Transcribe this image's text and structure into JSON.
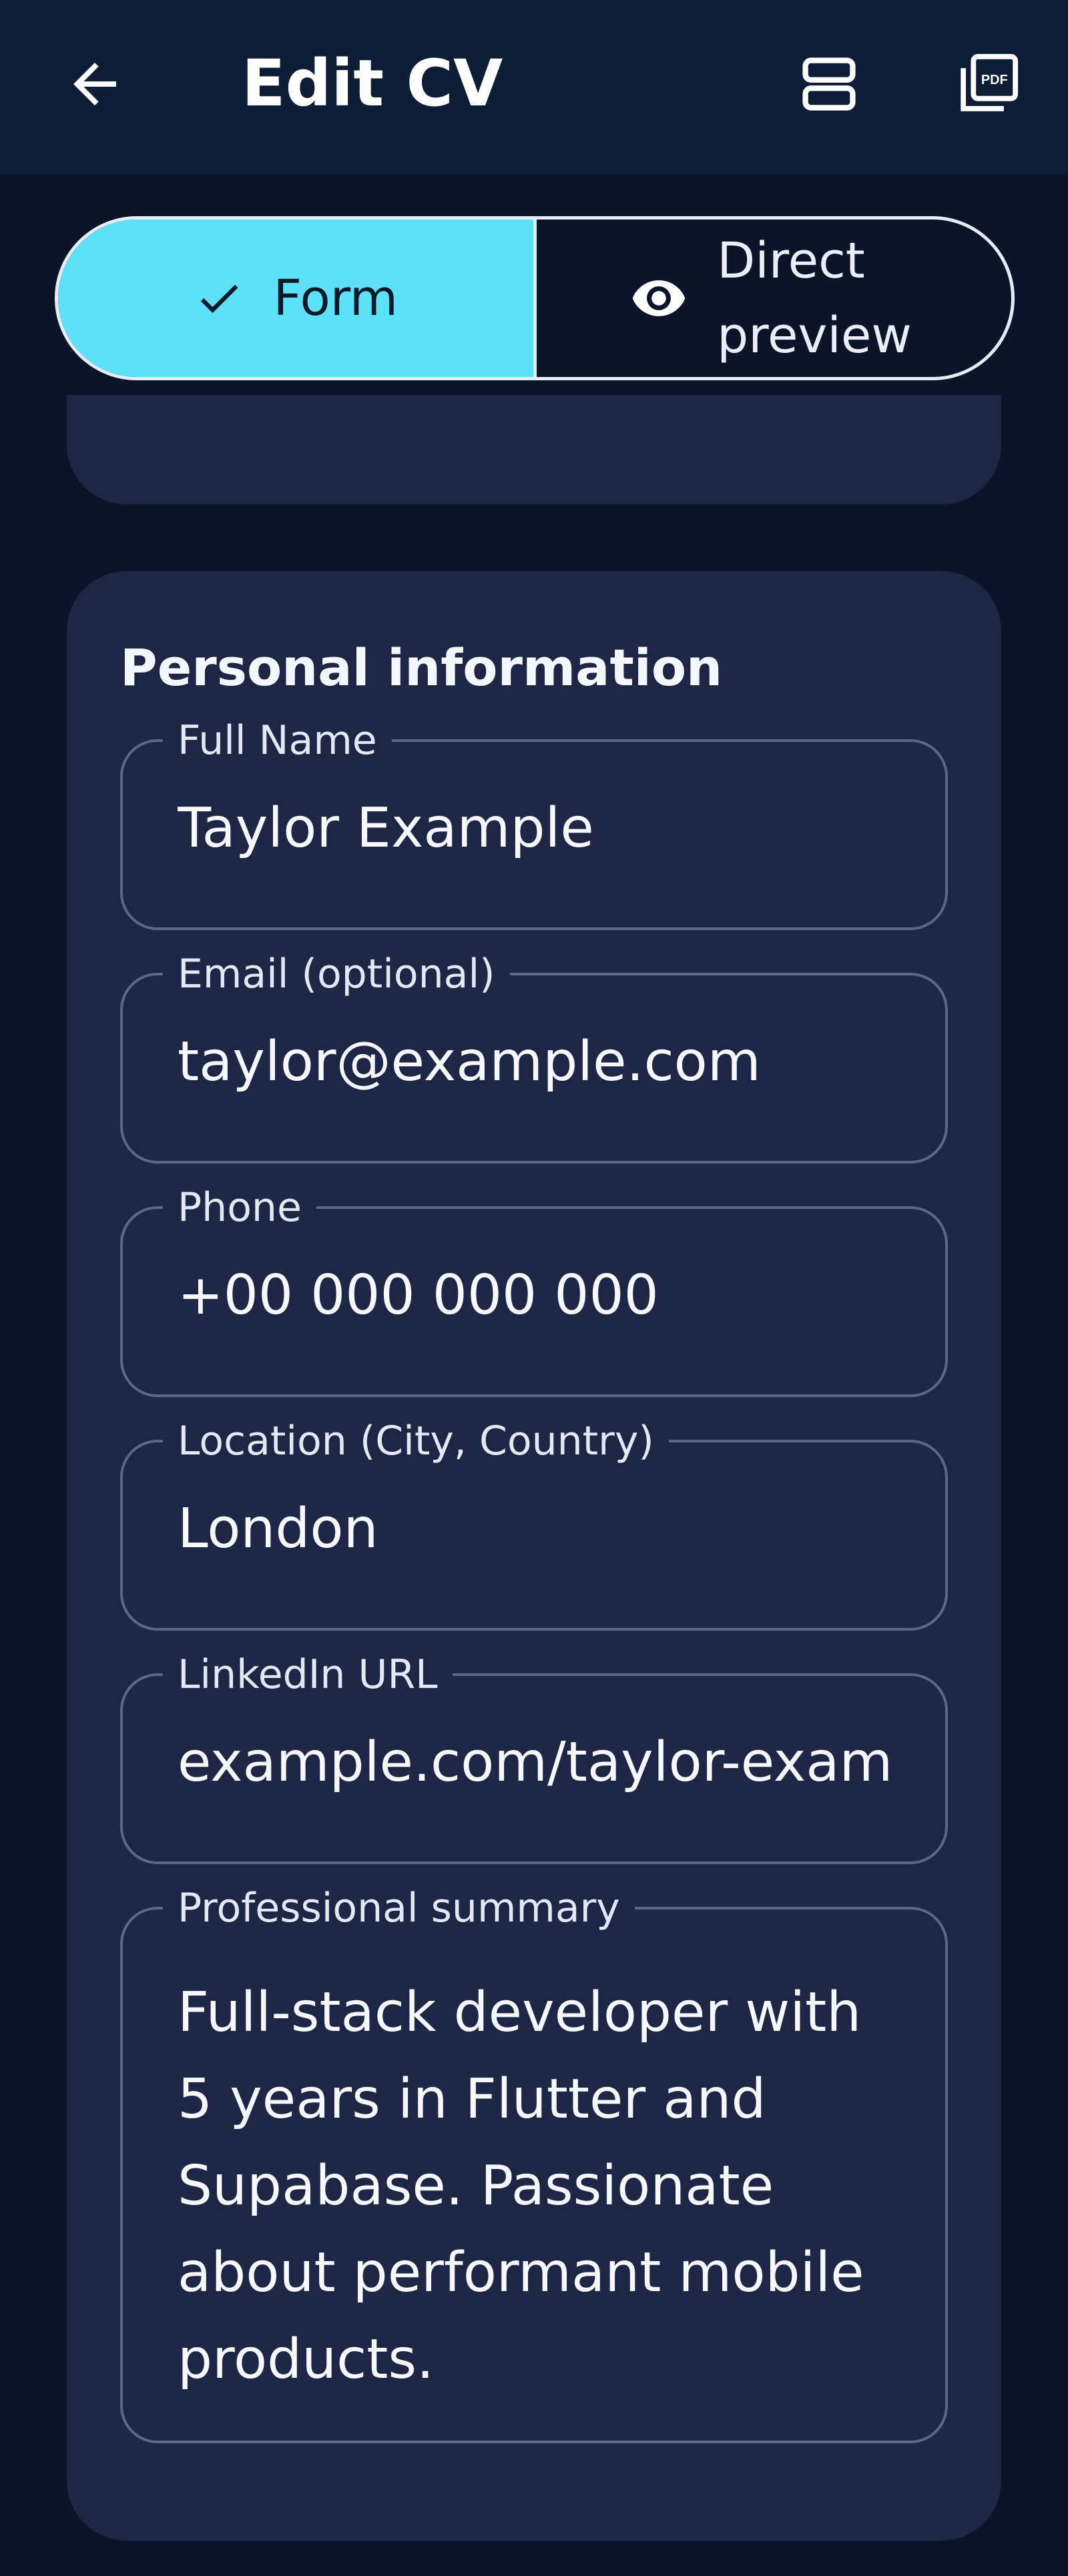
{
  "appbar": {
    "title": "Edit CV",
    "back_icon": "arrow-left-icon",
    "layout_icon": "view-agenda-icon",
    "pdf_icon": "picture-as-pdf-icon"
  },
  "toggle": {
    "form_label": "Form",
    "preview_label": "Direct preview",
    "selected": "Form"
  },
  "card": {
    "title": "Personal information",
    "fields": [
      {
        "label": "Full Name",
        "value": "Taylor Example"
      },
      {
        "label": "Email (optional)",
        "value": "taylor@example.com"
      },
      {
        "label": "Phone",
        "value": "+00 000 000 000"
      },
      {
        "label": "Location (City, Country)",
        "value": "London"
      },
      {
        "label": "LinkedIn URL",
        "value": "example.com/taylor-example"
      },
      {
        "label": "Professional summary",
        "value": "Full-stack developer with 5 years in Flutter and Supabase. Passionate about performant mobile products."
      }
    ]
  },
  "colors": {
    "accent": "#5ee1f6",
    "background": "#0c1429",
    "card": "#1d2644",
    "appbar": "#0d1d35"
  }
}
